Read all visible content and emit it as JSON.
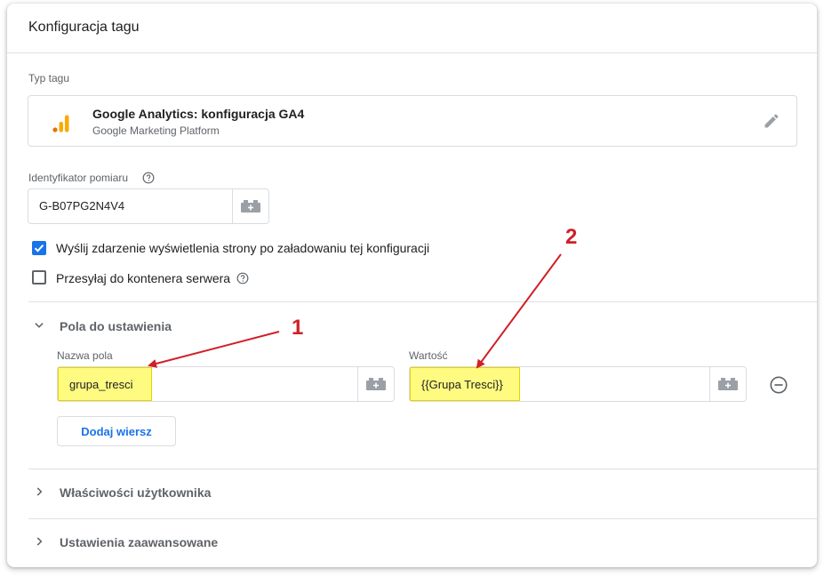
{
  "card": {
    "title": "Konfiguracja tagu"
  },
  "tag_type": {
    "label": "Typ tagu",
    "name": "Google Analytics: konfiguracja GA4",
    "platform": "Google Marketing Platform",
    "icon": "google-analytics-icon"
  },
  "measurement_id": {
    "label": "Identyfikator pomiaru",
    "value": "G-B07PG2N4V4"
  },
  "checkboxes": {
    "send_pageview": {
      "label": "Wyślij zdarzenie wyświetlenia strony po załadowaniu tej konfiguracji",
      "checked": true
    },
    "send_to_server": {
      "label": "Przesyłaj do kontenera serwera",
      "checked": false
    }
  },
  "fields_section": {
    "title": "Pola do ustawienia",
    "field_name_label": "Nazwa pola",
    "value_label": "Wartość",
    "rows": [
      {
        "field_name": "grupa_tresci",
        "value": "{{Grupa Tresci}}"
      }
    ],
    "add_row_label": "Dodaj wiersz"
  },
  "sections": {
    "user_properties": "Właściwości użytkownika",
    "advanced": "Ustawienia zaawansowane"
  },
  "annotations": {
    "one": "1",
    "two": "2"
  },
  "colors": {
    "accent": "#1a73e8",
    "highlight": "#fffb80",
    "annotation": "#d0202a"
  }
}
